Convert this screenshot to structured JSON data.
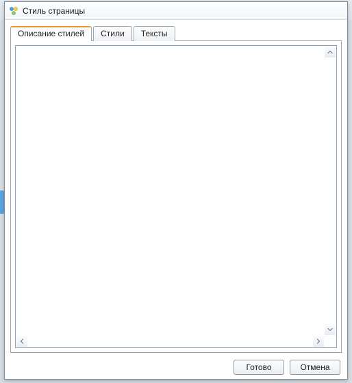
{
  "window": {
    "title": "Стиль страницы"
  },
  "tabs": [
    {
      "label": "Описание стилей",
      "active": true
    },
    {
      "label": "Стили",
      "active": false
    },
    {
      "label": "Тексты",
      "active": false
    }
  ],
  "buttons": {
    "ok": "Готово",
    "cancel": "Отмена"
  }
}
